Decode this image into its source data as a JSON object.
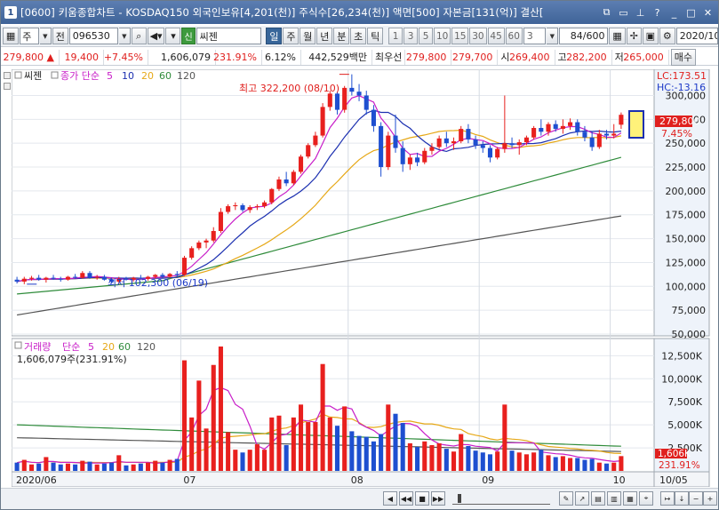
{
  "window": {
    "app_number": "1",
    "title": "[0600] 키움종합차트 - KOSDAQ150 외국인보유[4,201(천)] 주식수[26,234(천)] 액면[500] 자본금[131(억)] 결산["
  },
  "toolbar": {
    "type_label": "주",
    "prev_label": "전",
    "stock_code": "096530",
    "shin_label": "신",
    "stock_name": "씨젠",
    "periods": [
      "일",
      "주",
      "월",
      "년",
      "분",
      "초",
      "틱"
    ],
    "active_period": "일",
    "minute_intervals": [
      "1",
      "3",
      "5",
      "10",
      "15",
      "30",
      "45",
      "60"
    ],
    "custom_interval": "3",
    "count": "84/600",
    "date": "2020/10",
    "order_label": "매수"
  },
  "quote": {
    "price": "279,800",
    "change_arrow": "▲",
    "change": "19,400",
    "change_pct": "+7.45%",
    "volume": "1,606,079",
    "volume_ratio": "231.91%",
    "turnover": "6.12%",
    "amount": "442,529백만",
    "priority_label": "최우선",
    "ask": "279,800",
    "bid": "279,700",
    "open_label": "시",
    "open": "269,400",
    "high_label": "고",
    "high": "282,200",
    "low_label": "저",
    "low": "265,000"
  },
  "price_panel": {
    "legend_name": "씨젠",
    "ma_legend_prefix": "종가 단순",
    "ma_periods": [
      "5",
      "10",
      "20",
      "60",
      "120"
    ],
    "lc_label": "LC:173.51",
    "hc_label": "HC:-13.16",
    "max_label": "최고 322,200 (08/10)",
    "min_label": "최저 102,300 (06/19)",
    "current_price_label": "279,800",
    "current_pct_label": "7.45%",
    "y_ticks": [
      "300,000",
      "275,000",
      "250,000",
      "225,000",
      "200,000",
      "175,000",
      "150,000",
      "125,000",
      "100,000",
      "75,000",
      "50,000"
    ]
  },
  "volume_panel": {
    "legend_name": "거래량",
    "ma_legend_prefix": "단순",
    "ma_periods": [
      "5",
      "20",
      "60",
      "120"
    ],
    "current_volume_label": "1,606,079주(231.91%)",
    "right_volume_label": "1,606K",
    "right_pct_label": "231.91%",
    "y_ticks": [
      "12,500K",
      "10,000K",
      "7,500K",
      "5,000K",
      "2,500K"
    ]
  },
  "x_axis": {
    "labels": [
      "2020/06",
      "07",
      "08",
      "09",
      "10",
      "10/05"
    ]
  },
  "colors": {
    "up": "#e8201e",
    "down": "#1e4fd0",
    "ma5": "#c81ec8",
    "ma10": "#1b2fb0",
    "ma20": "#e6a817",
    "ma60": "#2e8b3a",
    "ma120": "#555555"
  },
  "chart_data": {
    "type": "candlestick",
    "price_range": [
      50000,
      320000
    ],
    "volume_range": [
      0,
      13500000
    ],
    "candles": [
      {
        "o": 107000,
        "h": 110000,
        "l": 103000,
        "c": 105000,
        "v": 900000
      },
      {
        "o": 105000,
        "h": 110000,
        "l": 102300,
        "c": 108000,
        "v": 1200000
      },
      {
        "o": 108000,
        "h": 111000,
        "l": 106000,
        "c": 109000,
        "v": 700000
      },
      {
        "o": 109000,
        "h": 112000,
        "l": 106000,
        "c": 107000,
        "v": 800000
      },
      {
        "o": 107000,
        "h": 110000,
        "l": 104000,
        "c": 109000,
        "v": 1500000
      },
      {
        "o": 109000,
        "h": 112000,
        "l": 107000,
        "c": 108000,
        "v": 900000
      },
      {
        "o": 108000,
        "h": 110000,
        "l": 105000,
        "c": 107000,
        "v": 700000
      },
      {
        "o": 107000,
        "h": 111000,
        "l": 106000,
        "c": 110000,
        "v": 800000
      },
      {
        "o": 110000,
        "h": 113000,
        "l": 108000,
        "c": 109000,
        "v": 700000
      },
      {
        "o": 109000,
        "h": 116000,
        "l": 108000,
        "c": 114000,
        "v": 1100000
      },
      {
        "o": 114000,
        "h": 116000,
        "l": 108000,
        "c": 109000,
        "v": 1000000
      },
      {
        "o": 109000,
        "h": 112000,
        "l": 107000,
        "c": 110000,
        "v": 700000
      },
      {
        "o": 110000,
        "h": 112000,
        "l": 106000,
        "c": 107000,
        "v": 800000
      },
      {
        "o": 107000,
        "h": 109000,
        "l": 103000,
        "c": 105000,
        "v": 900000
      },
      {
        "o": 105000,
        "h": 110000,
        "l": 102300,
        "c": 108000,
        "v": 1700000
      },
      {
        "o": 108000,
        "h": 110000,
        "l": 106000,
        "c": 107000,
        "v": 600000
      },
      {
        "o": 107000,
        "h": 110000,
        "l": 105000,
        "c": 109000,
        "v": 700000
      },
      {
        "o": 109000,
        "h": 112000,
        "l": 107000,
        "c": 108000,
        "v": 800000
      },
      {
        "o": 108000,
        "h": 111000,
        "l": 106000,
        "c": 110000,
        "v": 900000
      },
      {
        "o": 110000,
        "h": 113000,
        "l": 108000,
        "c": 112000,
        "v": 1100000
      },
      {
        "o": 112000,
        "h": 114000,
        "l": 109000,
        "c": 110000,
        "v": 900000
      },
      {
        "o": 110000,
        "h": 114000,
        "l": 109000,
        "c": 113000,
        "v": 1200000
      },
      {
        "o": 113000,
        "h": 116000,
        "l": 110000,
        "c": 112000,
        "v": 1300000
      },
      {
        "o": 112000,
        "h": 132000,
        "l": 111000,
        "c": 130000,
        "v": 12000000
      },
      {
        "o": 130000,
        "h": 142000,
        "l": 128000,
        "c": 140000,
        "v": 5800000
      },
      {
        "o": 140000,
        "h": 148000,
        "l": 138000,
        "c": 146000,
        "v": 9800000
      },
      {
        "o": 146000,
        "h": 150000,
        "l": 140000,
        "c": 148000,
        "v": 4600000
      },
      {
        "o": 148000,
        "h": 162000,
        "l": 146000,
        "c": 158000,
        "v": 11500000
      },
      {
        "o": 158000,
        "h": 182000,
        "l": 156000,
        "c": 178000,
        "v": 13500000
      },
      {
        "o": 178000,
        "h": 186000,
        "l": 176000,
        "c": 184000,
        "v": 4200000
      },
      {
        "o": 184000,
        "h": 188000,
        "l": 180000,
        "c": 185000,
        "v": 2300000
      },
      {
        "o": 185000,
        "h": 187000,
        "l": 178000,
        "c": 180000,
        "v": 2000000
      },
      {
        "o": 180000,
        "h": 185000,
        "l": 177000,
        "c": 183000,
        "v": 2300000
      },
      {
        "o": 183000,
        "h": 186000,
        "l": 180000,
        "c": 184000,
        "v": 2900000
      },
      {
        "o": 184000,
        "h": 190000,
        "l": 182000,
        "c": 188000,
        "v": 2300000
      },
      {
        "o": 188000,
        "h": 203000,
        "l": 186000,
        "c": 202000,
        "v": 5800000
      },
      {
        "o": 202000,
        "h": 215000,
        "l": 200000,
        "c": 212000,
        "v": 6000000
      },
      {
        "o": 212000,
        "h": 220000,
        "l": 205000,
        "c": 208000,
        "v": 2800000
      },
      {
        "o": 208000,
        "h": 222000,
        "l": 206000,
        "c": 220000,
        "v": 5800000
      },
      {
        "o": 220000,
        "h": 238000,
        "l": 218000,
        "c": 236000,
        "v": 7200000
      },
      {
        "o": 236000,
        "h": 250000,
        "l": 234000,
        "c": 248000,
        "v": 5300000
      },
      {
        "o": 248000,
        "h": 262000,
        "l": 246000,
        "c": 258000,
        "v": 5300000
      },
      {
        "o": 258000,
        "h": 292000,
        "l": 256000,
        "c": 288000,
        "v": 11600000
      },
      {
        "o": 288000,
        "h": 305000,
        "l": 284000,
        "c": 302000,
        "v": 5800000
      },
      {
        "o": 302000,
        "h": 304000,
        "l": 280000,
        "c": 285000,
        "v": 4900000
      },
      {
        "o": 285000,
        "h": 310000,
        "l": 282000,
        "c": 308000,
        "v": 7000000
      },
      {
        "o": 308000,
        "h": 322200,
        "l": 300000,
        "c": 304000,
        "v": 4300000
      },
      {
        "o": 304000,
        "h": 312000,
        "l": 294000,
        "c": 300000,
        "v": 3800000
      },
      {
        "o": 300000,
        "h": 305000,
        "l": 280000,
        "c": 285000,
        "v": 3700000
      },
      {
        "o": 285000,
        "h": 290000,
        "l": 262000,
        "c": 268000,
        "v": 3200000
      },
      {
        "o": 268000,
        "h": 272000,
        "l": 215000,
        "c": 225000,
        "v": 4000000
      },
      {
        "o": 225000,
        "h": 262000,
        "l": 222000,
        "c": 258000,
        "v": 7200000
      },
      {
        "o": 258000,
        "h": 280000,
        "l": 240000,
        "c": 245000,
        "v": 6200000
      },
      {
        "o": 245000,
        "h": 252000,
        "l": 220000,
        "c": 228000,
        "v": 5200000
      },
      {
        "o": 228000,
        "h": 238000,
        "l": 222000,
        "c": 235000,
        "v": 3000000
      },
      {
        "o": 235000,
        "h": 240000,
        "l": 226000,
        "c": 230000,
        "v": 2600000
      },
      {
        "o": 230000,
        "h": 245000,
        "l": 228000,
        "c": 242000,
        "v": 3200000
      },
      {
        "o": 242000,
        "h": 250000,
        "l": 238000,
        "c": 246000,
        "v": 2800000
      },
      {
        "o": 246000,
        "h": 258000,
        "l": 244000,
        "c": 255000,
        "v": 3000000
      },
      {
        "o": 255000,
        "h": 262000,
        "l": 246000,
        "c": 250000,
        "v": 2400000
      },
      {
        "o": 250000,
        "h": 256000,
        "l": 243000,
        "c": 252000,
        "v": 2100000
      },
      {
        "o": 252000,
        "h": 268000,
        "l": 250000,
        "c": 265000,
        "v": 4000000
      },
      {
        "o": 265000,
        "h": 270000,
        "l": 250000,
        "c": 254000,
        "v": 2700000
      },
      {
        "o": 254000,
        "h": 258000,
        "l": 244000,
        "c": 248000,
        "v": 2200000
      },
      {
        "o": 248000,
        "h": 252000,
        "l": 240000,
        "c": 245000,
        "v": 2000000
      },
      {
        "o": 245000,
        "h": 248000,
        "l": 230000,
        "c": 235000,
        "v": 1800000
      },
      {
        "o": 235000,
        "h": 246000,
        "l": 233000,
        "c": 244000,
        "v": 2100000
      },
      {
        "o": 244000,
        "h": 300000,
        "l": 240000,
        "c": 250000,
        "v": 7200000
      },
      {
        "o": 250000,
        "h": 256000,
        "l": 245000,
        "c": 248000,
        "v": 2200000
      },
      {
        "o": 248000,
        "h": 254000,
        "l": 238000,
        "c": 251000,
        "v": 2000000
      },
      {
        "o": 251000,
        "h": 258000,
        "l": 248000,
        "c": 256000,
        "v": 1800000
      },
      {
        "o": 256000,
        "h": 268000,
        "l": 254000,
        "c": 266000,
        "v": 2000000
      },
      {
        "o": 266000,
        "h": 275000,
        "l": 258000,
        "c": 262000,
        "v": 2300000
      },
      {
        "o": 262000,
        "h": 272000,
        "l": 258000,
        "c": 270000,
        "v": 1700000
      },
      {
        "o": 270000,
        "h": 274000,
        "l": 262000,
        "c": 265000,
        "v": 1500000
      },
      {
        "o": 265000,
        "h": 275000,
        "l": 260000,
        "c": 268000,
        "v": 1600000
      },
      {
        "o": 268000,
        "h": 276000,
        "l": 264000,
        "c": 272000,
        "v": 1400000
      },
      {
        "o": 272000,
        "h": 275000,
        "l": 258000,
        "c": 262000,
        "v": 1400000
      },
      {
        "o": 262000,
        "h": 268000,
        "l": 252000,
        "c": 256000,
        "v": 1200000
      },
      {
        "o": 256000,
        "h": 262000,
        "l": 242000,
        "c": 246000,
        "v": 1300000
      },
      {
        "o": 246000,
        "h": 264000,
        "l": 244000,
        "c": 260000,
        "v": 900000
      },
      {
        "o": 260000,
        "h": 264000,
        "l": 254000,
        "c": 258000,
        "v": 800000
      },
      {
        "o": 258000,
        "h": 270000,
        "l": 255000,
        "c": 260000,
        "v": 900000
      },
      {
        "o": 269400,
        "h": 282200,
        "l": 265000,
        "c": 279800,
        "v": 1606079
      }
    ]
  }
}
